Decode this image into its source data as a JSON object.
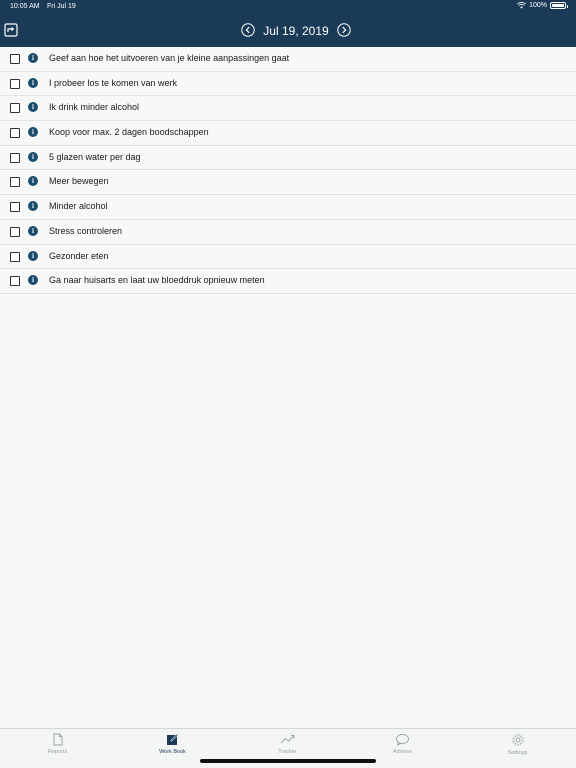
{
  "status_bar": {
    "time": "10:05 AM",
    "date": "Fri Jul 19",
    "battery": "100%"
  },
  "header": {
    "date": "Jul 19, 2019",
    "bg_color": "#1b3a57"
  },
  "items": [
    {
      "label": "Geef aan hoe het uitvoeren van je kleine aanpassingen gaat",
      "checked": false
    },
    {
      "label": "I probeer los te komen van werk",
      "checked": false
    },
    {
      "label": "Ik drink minder alcohol",
      "checked": false
    },
    {
      "label": "Koop voor max. 2 dagen boodschappen",
      "checked": false
    },
    {
      "label": "5 glazen water per dag",
      "checked": false
    },
    {
      "label": "Meer bewegen",
      "checked": false
    },
    {
      "label": "Minder alcohol",
      "checked": false
    },
    {
      "label": "Stress controleren",
      "checked": false
    },
    {
      "label": "Gezonder eten",
      "checked": false
    },
    {
      "label": "Ga naar huisarts en laat uw bloeddruk opnieuw meten",
      "checked": false
    }
  ],
  "tabs": [
    {
      "label": "Reports",
      "icon": "document-icon",
      "active": false
    },
    {
      "label": "Work Book",
      "icon": "pencil-note-icon",
      "active": true
    },
    {
      "label": "Tracker",
      "icon": "trend-line-icon",
      "active": false
    },
    {
      "label": "Advices",
      "icon": "speech-bubble-icon",
      "active": false
    },
    {
      "label": "Settings",
      "icon": "gear-icon",
      "active": false
    }
  ]
}
